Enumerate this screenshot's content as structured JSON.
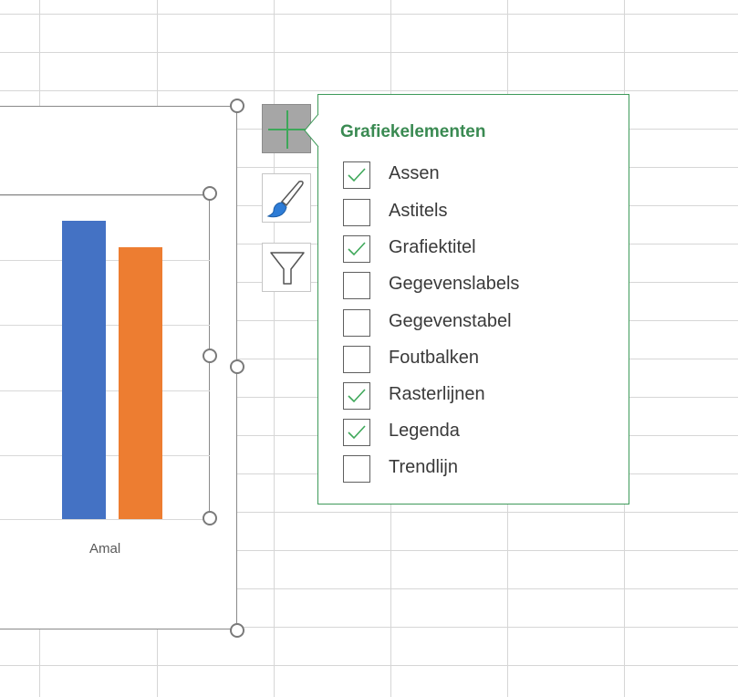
{
  "chart": {
    "category_label": "Amal",
    "colors": {
      "series1": "#4472c4",
      "series2": "#ed7d31"
    }
  },
  "chart_data": {
    "type": "bar",
    "categories": [
      "Amal"
    ],
    "series": [
      {
        "values": [
          0.92
        ]
      },
      {
        "values": [
          0.84
        ]
      }
    ],
    "xlabel": "",
    "ylabel": "",
    "grid": true
  },
  "side_buttons": {
    "elements_icon": "plus-icon",
    "styles_icon": "paintbrush-icon",
    "filter_icon": "funnel-icon"
  },
  "flyout": {
    "title": "Grafiekelementen",
    "accent": "#3a8a52",
    "options": [
      {
        "label": "Assen",
        "checked": true
      },
      {
        "label": "Astitels",
        "checked": false
      },
      {
        "label": "Grafiektitel",
        "checked": true
      },
      {
        "label": "Gegevenslabels",
        "checked": false
      },
      {
        "label": "Gegevenstabel",
        "checked": false
      },
      {
        "label": "Foutbalken",
        "checked": false
      },
      {
        "label": "Rasterlijnen",
        "checked": true
      },
      {
        "label": "Legenda",
        "checked": true
      },
      {
        "label": "Trendlijn",
        "checked": false
      }
    ]
  }
}
